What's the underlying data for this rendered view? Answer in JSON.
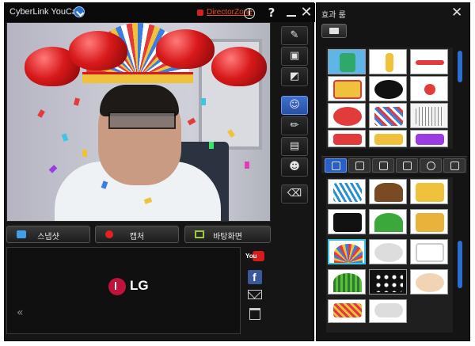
{
  "window": {
    "title": "CyberLink YouCam",
    "director_zone": "DirectorZone",
    "help": "?",
    "close": "✕",
    "info": "i"
  },
  "actions": {
    "snapshot": "스냅샷",
    "capture": "캡처",
    "wallpaper": "바탕화면"
  },
  "thumbnail": {
    "brand": "LG",
    "scroll_left": "«"
  },
  "share": {
    "youtube": "You",
    "facebook": "f"
  },
  "effects_panel": {
    "title": "효과 룸",
    "close": "✕"
  },
  "colors": {
    "accent": "#2a5fc7",
    "brand_red": "#c0123a",
    "director_zone": "#e34b2b"
  }
}
